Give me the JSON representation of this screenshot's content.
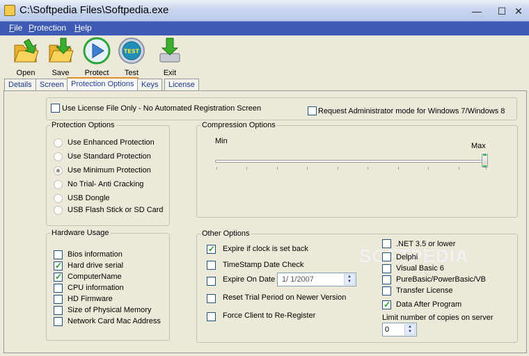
{
  "window": {
    "title": "C:\\Softpedia Files\\Softpedia.exe"
  },
  "menu": [
    {
      "label": "File",
      "hotkey": "F",
      "rest": "ile"
    },
    {
      "label": "Protection",
      "hotkey": "P",
      "rest": "rotection"
    },
    {
      "label": "Help",
      "hotkey": "H",
      "rest": "elp"
    }
  ],
  "toolbar": [
    {
      "label": "Open",
      "icon": "folder-open-icon"
    },
    {
      "label": "Save",
      "icon": "folder-save-icon"
    },
    {
      "label": "Protect",
      "icon": "play-icon"
    },
    {
      "label": "Test",
      "icon": "test-badge-icon",
      "badge": "TEST"
    },
    {
      "label": "Exit",
      "icon": "exit-icon"
    }
  ],
  "tabs": [
    {
      "label": "Details",
      "active": false
    },
    {
      "label": "Screen",
      "active": false
    },
    {
      "label": "Protection Options",
      "active": true
    },
    {
      "label": "Keys",
      "active": false
    },
    {
      "label": "License",
      "active": false
    }
  ],
  "top_options": {
    "license_file_only": {
      "label": "Use License File Only - No Automated Registration Screen",
      "checked": false
    },
    "admin_mode": {
      "label": "Request Administrator mode for Windows 7/Windows 8",
      "checked": false
    }
  },
  "protection_options": {
    "title": "Protection Options",
    "items": [
      {
        "label": "Use Enhanced Protection",
        "selected": false
      },
      {
        "label": "Use Standard Protection",
        "selected": false
      },
      {
        "label": "Use Minimum Protection",
        "selected": true
      },
      {
        "label": "No Trial- Anti Cracking",
        "selected": false
      },
      {
        "label": "USB Dongle",
        "selected": false
      },
      {
        "label": "USB Flash Stick or SD Card",
        "selected": false
      }
    ]
  },
  "compression": {
    "title": "Compression Options",
    "min_label": "Min",
    "max_label": "Max",
    "level_fraction": 1.0
  },
  "hardware_usage": {
    "title": "Hardware Usage",
    "items": [
      {
        "label": "Bios information",
        "checked": false
      },
      {
        "label": "Hard drive serial",
        "checked": true
      },
      {
        "label": "ComputerName",
        "checked": true
      },
      {
        "label": "CPU information",
        "checked": false
      },
      {
        "label": "HD Firmware",
        "checked": false
      },
      {
        "label": "Size of Physical Memory",
        "checked": false
      },
      {
        "label": "Network Card Mac Address",
        "checked": false
      }
    ]
  },
  "other_options": {
    "title": "Other Options",
    "expire_clock": {
      "label": "Expire if clock is set back",
      "checked": true
    },
    "timestamp": {
      "label": "TimeStamp Date Check",
      "checked": false
    },
    "expire_on_date": {
      "label": "Expire On Date",
      "checked": false,
      "date": "1/ 1/2007"
    },
    "reset_trial": {
      "label": "Reset Trial Period on Newer Version",
      "checked": false
    },
    "force_reregister": {
      "label": "Force Client to Re-Register",
      "checked": false
    },
    "right_items": [
      {
        "label": ".NET 3.5 or lower",
        "checked": false
      },
      {
        "label": "Delphi",
        "checked": false
      },
      {
        "label": "Visual Basic 6",
        "checked": false
      },
      {
        "label": "PureBasic/PowerBasic/VB",
        "checked": false
      },
      {
        "label": "Transfer License",
        "checked": false
      },
      {
        "label": "Data After Program",
        "checked": true
      }
    ],
    "copies_label": "Limit number of copies on server",
    "copies_value": "0"
  },
  "watermark": "SOFTPEDIA",
  "colors": {
    "menubar": "#3d5ab5",
    "active_tab_accent": "#e68b2c",
    "check": "#21a121"
  }
}
